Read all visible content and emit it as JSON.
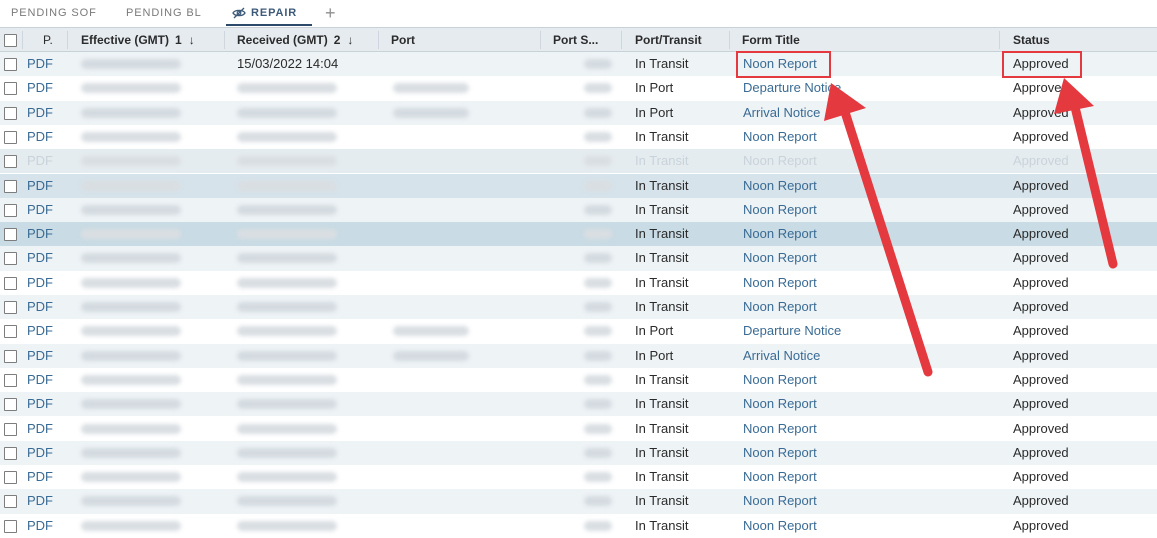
{
  "tabs": [
    {
      "label": "PENDING SOF"
    },
    {
      "label": "PENDING BL"
    },
    {
      "label": "REPAIR"
    }
  ],
  "add_tab_label": "+",
  "columns": {
    "p": "P.",
    "effective": "Effective (GMT)",
    "effective_sort": "1",
    "received": "Received (GMT)",
    "received_sort": "2",
    "sort_arrow": "↓",
    "port": "Port",
    "port_s": "Port S...",
    "port_transit": "Port/Transit",
    "form_title": "Form Title",
    "status": "Status"
  },
  "rows": [
    {
      "pdf": "PDF",
      "received": "15/03/2022 14:04",
      "transit": "In Transit",
      "form": "Noon Report",
      "status": "Approved"
    },
    {
      "pdf": "PDF",
      "received": "",
      "transit": "In Port",
      "form": "Departure Notice",
      "status": "Approved"
    },
    {
      "pdf": "PDF",
      "received": "",
      "transit": "In Port",
      "form": "Arrival Notice",
      "status": "Approved"
    },
    {
      "pdf": "PDF",
      "received": "",
      "transit": "In Transit",
      "form": "Noon Report",
      "status": "Approved"
    },
    {
      "pdf": "PDF",
      "received": "",
      "transit": "In Transit",
      "form": "Noon Report",
      "status": "Approved"
    },
    {
      "pdf": "PDF",
      "received": "",
      "transit": "In Transit",
      "form": "Noon Report",
      "status": "Approved"
    },
    {
      "pdf": "PDF",
      "received": "",
      "transit": "In Transit",
      "form": "Noon Report",
      "status": "Approved"
    },
    {
      "pdf": "PDF",
      "received": "",
      "transit": "In Transit",
      "form": "Noon Report",
      "status": "Approved"
    },
    {
      "pdf": "PDF",
      "received": "",
      "transit": "In Transit",
      "form": "Noon Report",
      "status": "Approved"
    },
    {
      "pdf": "PDF",
      "received": "",
      "transit": "In Transit",
      "form": "Noon Report",
      "status": "Approved"
    },
    {
      "pdf": "PDF",
      "received": "",
      "transit": "In Transit",
      "form": "Noon Report",
      "status": "Approved"
    },
    {
      "pdf": "PDF",
      "received": "",
      "transit": "In Port",
      "form": "Departure Notice",
      "status": "Approved"
    },
    {
      "pdf": "PDF",
      "received": "",
      "transit": "In Port",
      "form": "Arrival Notice",
      "status": "Approved"
    },
    {
      "pdf": "PDF",
      "received": "",
      "transit": "In Transit",
      "form": "Noon Report",
      "status": "Approved"
    },
    {
      "pdf": "PDF",
      "received": "",
      "transit": "In Transit",
      "form": "Noon Report",
      "status": "Approved"
    },
    {
      "pdf": "PDF",
      "received": "",
      "transit": "In Transit",
      "form": "Noon Report",
      "status": "Approved"
    },
    {
      "pdf": "PDF",
      "received": "",
      "transit": "In Transit",
      "form": "Noon Report",
      "status": "Approved"
    },
    {
      "pdf": "PDF",
      "received": "",
      "transit": "In Transit",
      "form": "Noon Report",
      "status": "Approved"
    },
    {
      "pdf": "PDF",
      "received": "",
      "transit": "In Transit",
      "form": "Noon Report",
      "status": "Approved"
    },
    {
      "pdf": "PDF",
      "received": "",
      "transit": "In Transit",
      "form": "Noon Report",
      "status": "Approved"
    }
  ],
  "icons": {
    "repair_tab": "eye-slash-icon",
    "add_tab": "plus-icon",
    "sort": "arrow-down-icon"
  },
  "colors": {
    "link": "#3a6b94",
    "header_bg": "#e6ebf0",
    "annotation_red": "#e3393f"
  }
}
